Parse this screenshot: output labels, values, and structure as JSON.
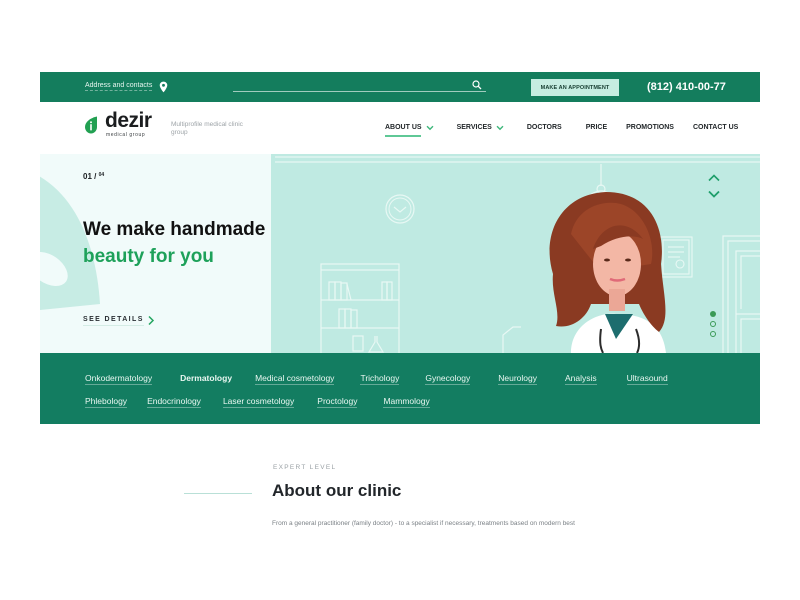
{
  "topbar": {
    "address_label": "Address and contacts",
    "search": {
      "value": "",
      "placeholder": ""
    },
    "appointment_button": "MAKE AN APPOINTMENT",
    "phone": "(812) 410-00-77"
  },
  "header": {
    "brand": "dezir",
    "brand_sub": "medical group",
    "tagline": "Multiprofile medical clinic group",
    "nav": [
      {
        "label": "ABOUT US",
        "has_dropdown": true,
        "active": true
      },
      {
        "label": "SERVICES",
        "has_dropdown": true,
        "active": false
      },
      {
        "label": "DOCTORS",
        "has_dropdown": false,
        "active": false
      },
      {
        "label": "PRICE",
        "has_dropdown": false,
        "active": false
      },
      {
        "label": "PROMOTIONS",
        "has_dropdown": false,
        "active": false
      },
      {
        "label": "CONTACT US",
        "has_dropdown": false,
        "active": false
      }
    ]
  },
  "hero": {
    "slide_current": "01",
    "slide_separator": "/",
    "slide_total": "04",
    "title": "We make handmade",
    "subtitle": "beauty for you",
    "cta": "SEE DETAILS",
    "pager_dots": 3,
    "active_dot": 0,
    "icons": [
      "chevron-up-icon",
      "chevron-down-icon",
      "chevron-right-icon",
      "scroll-down-icon"
    ]
  },
  "services": {
    "rows": [
      [
        "Onkodermatology",
        "Dermatology",
        "Medical cosmetology",
        "Trichology",
        "Gynecology",
        "Neurology",
        "Analysis",
        "Ultrasound"
      ],
      [
        "Phlebology",
        "Endocrinology",
        "Laser cosmetology",
        "Proctology",
        "Mammology"
      ]
    ]
  },
  "about": {
    "eyebrow": "EXPERT LEVEL",
    "title": "About our clinic",
    "text": "From a general practitioner (family doctor) - to a specialist if necessary, treatments based on modern best"
  },
  "colors": {
    "primary_green": "#147d5d",
    "accent_green": "#1ea15a",
    "hero_mint": "#bfeae2",
    "hero_light": "#f1fbfa",
    "button_mint": "#c6ede1"
  }
}
